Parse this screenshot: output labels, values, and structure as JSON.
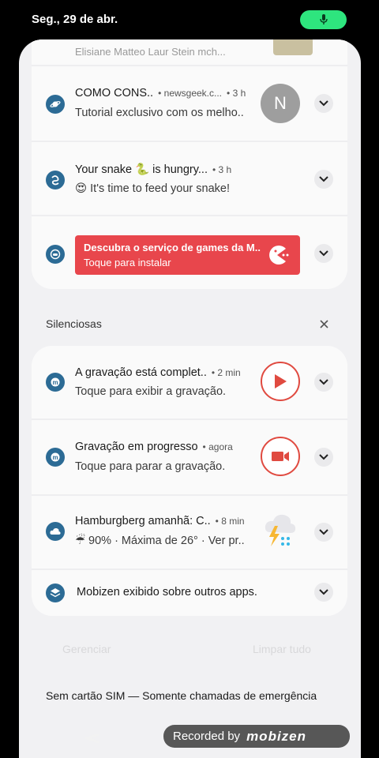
{
  "status_bar": {
    "date": "Seg., 29 de abr."
  },
  "notifications": {
    "peek": {
      "text": "Elisiane Matteo Laur Stein mch..."
    },
    "newsgeek": {
      "title": "COMO CONS..",
      "source": "newsgeek.c...",
      "time": "3 h",
      "text": "Tutorial exclusivo com os melho..",
      "avatar_letter": "N"
    },
    "snake": {
      "title": "Your snake 🐍 is hungry...",
      "time": "3 h",
      "text": "😍 It's time to feed your snake!"
    },
    "games": {
      "title": "Descubra o serviço de games da M..",
      "text": "Toque para instalar"
    }
  },
  "silent": {
    "header": "Silenciosas",
    "items": [
      {
        "title": "A gravação está complet..",
        "time": "2 min",
        "text": "Toque para exibir a gravação."
      },
      {
        "title": "Gravação em progresso",
        "time": "agora",
        "text": "Toque para parar a gravação."
      },
      {
        "title": "Hamburgberg amanhã: C..",
        "time": "8 min",
        "text": "☔ 90% · Máxima de 26° · Ver pr.."
      },
      {
        "title": "Mobizen exibido sobre outros apps."
      }
    ]
  },
  "footer": {
    "manage": "Gerenciar",
    "clear_all": "Limpar tudo",
    "sim_text": "Sem cartão SIM — Somente chamadas de emergência"
  },
  "recording_banner": {
    "label": "Recorded by",
    "brand": "mobizen"
  },
  "colors": {
    "accent_green": "#2ee57e",
    "record_red": "#e04a40",
    "promo_red": "#e8464c",
    "icon_blue": "#2c6b95"
  }
}
